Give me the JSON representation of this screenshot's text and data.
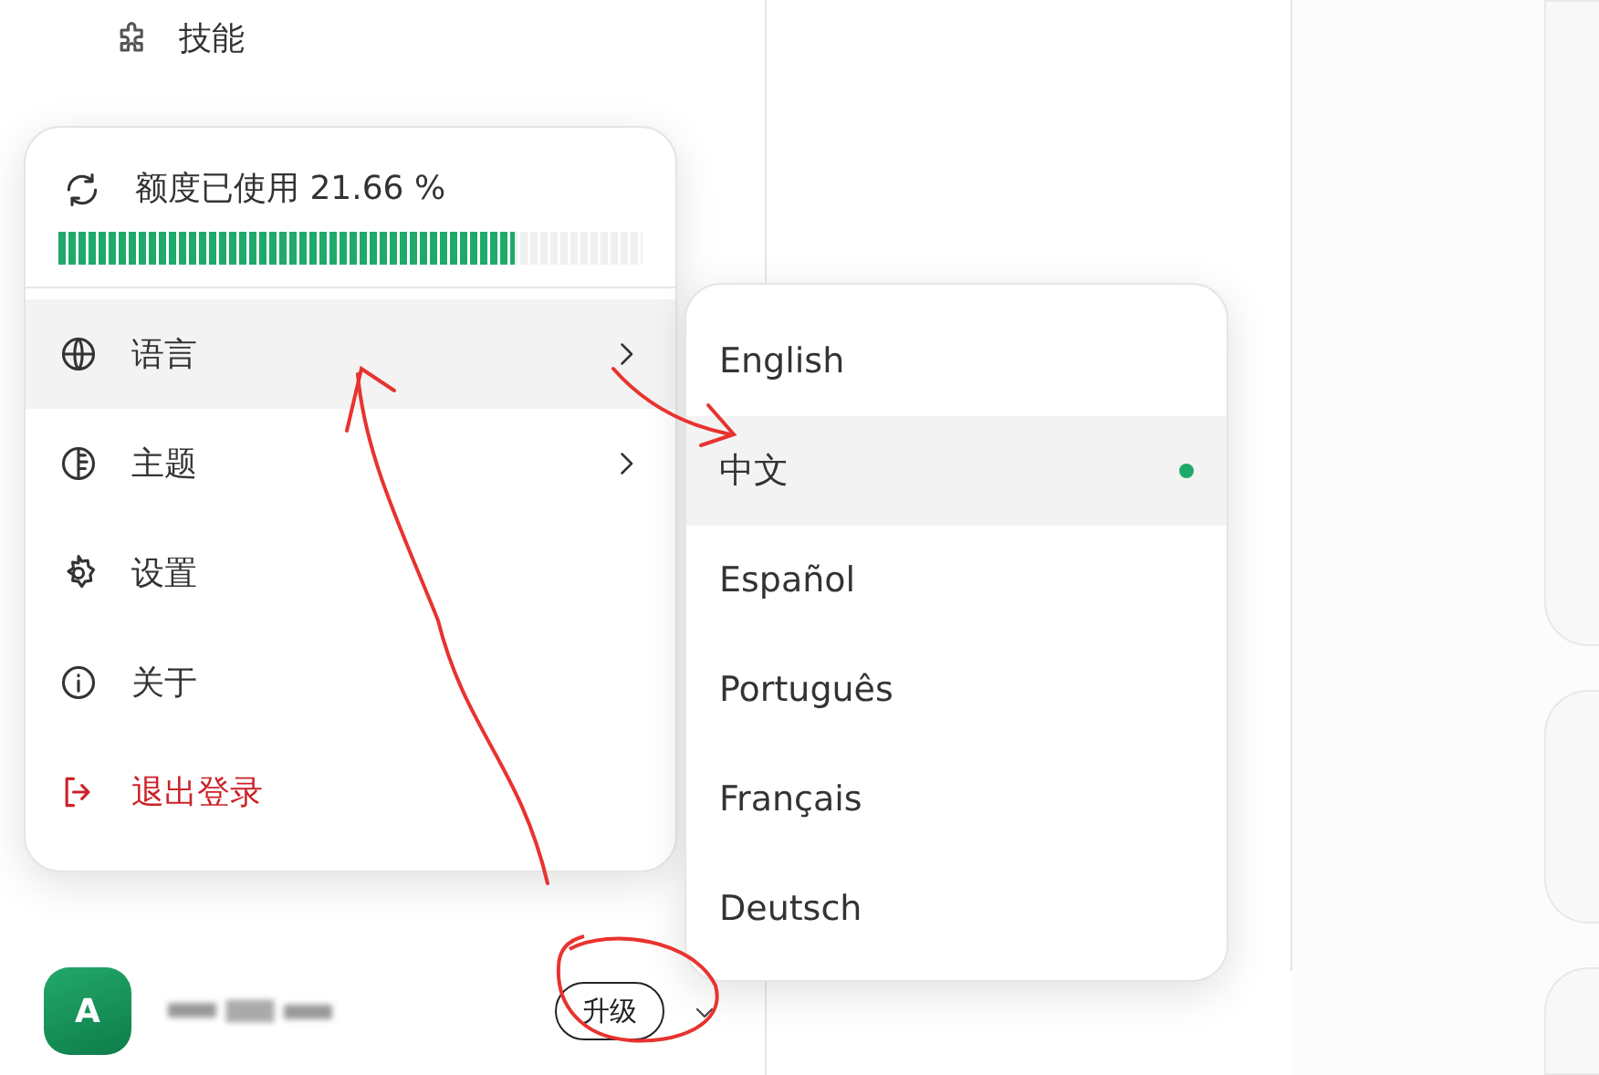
{
  "sidebar": {
    "items": [
      {
        "label": "技能"
      }
    ]
  },
  "quota": {
    "label": "额度已使用 21.66 %",
    "level": 0.78
  },
  "menu": {
    "items": [
      {
        "kind": "submenu",
        "label": "语言",
        "selected": true
      },
      {
        "kind": "submenu",
        "label": "主题",
        "selected": false
      },
      {
        "kind": "action",
        "label": "设置",
        "selected": false
      },
      {
        "kind": "action",
        "label": "关于",
        "selected": false
      },
      {
        "kind": "danger",
        "label": "退出登录",
        "selected": false
      }
    ]
  },
  "languages": [
    {
      "label": "English",
      "selected": false
    },
    {
      "label": "中文",
      "selected": true
    },
    {
      "label": "Español",
      "selected": false
    },
    {
      "label": "Português",
      "selected": false
    },
    {
      "label": "Français",
      "selected": false
    },
    {
      "label": "Deutsch",
      "selected": false
    }
  ],
  "user": {
    "avatar": "A",
    "upgrade": "升级"
  }
}
